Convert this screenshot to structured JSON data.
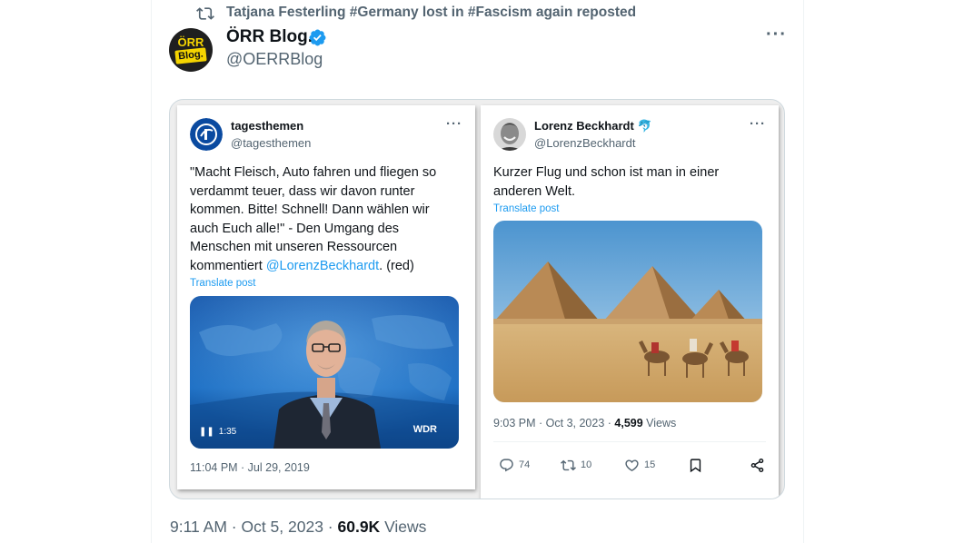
{
  "repost": {
    "text": "Tatjana Festerling #Germany lost in #Fascism again reposted"
  },
  "author": {
    "name": "ÖRR Blog.",
    "handle": "@OERRBlog",
    "avatar_top": "ÖRR",
    "avatar_bottom": "Blog."
  },
  "left_card": {
    "name": "tagesthemen",
    "handle": "@tagesthemen",
    "text_lines": [
      "\"Macht Fleisch, Auto fahren und fliegen so",
      "verdammt teuer, dass wir davon runter",
      "kommen. Bitte! Schnell! Dann wählen wir",
      "auch Euch alle!\" - Den Umgang des",
      "Menschen mit unseren Ressourcen"
    ],
    "last_line_prefix": "kommentiert ",
    "mention": "@LorenzBeckhardt",
    "last_line_suffix": ". (red)",
    "translate": "Translate post",
    "video_duration": "1:35",
    "video_brand": "WDR",
    "time": "11:04 PM · Jul 29, 2019"
  },
  "right_card": {
    "name": "Lorenz Beckhardt",
    "handle": "@LorenzBeckhardt",
    "text_lines": [
      "Kurzer Flug und schon ist man in einer",
      "anderen Welt."
    ],
    "translate": "Translate post",
    "time_prefix": "9:03 PM · Oct 3, 2023 · ",
    "views": "4,599",
    "views_label": " Views",
    "actions": {
      "replies": "74",
      "reposts": "10",
      "likes": "15"
    }
  },
  "footer": {
    "time_prefix": "9:11 AM · Oct 5, 2023 · ",
    "views": "60.9K",
    "views_label": " Views"
  },
  "colors": {
    "link": "#1d9bf0",
    "secondary": "#536471",
    "brand_yellow": "#f4d400"
  }
}
